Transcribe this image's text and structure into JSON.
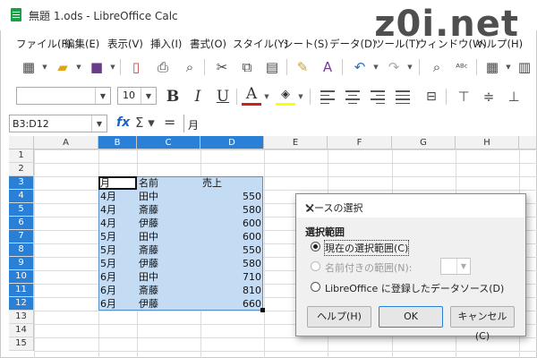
{
  "window": {
    "title": "無題 1.ods - LibreOffice Calc",
    "watermark": "z0i.net"
  },
  "menu": [
    "ファイル(F)",
    "編集(E)",
    "表示(V)",
    "挿入(I)",
    "書式(O)",
    "スタイル(Y)",
    "シート(S)",
    "データ(D)",
    "ツール(T)",
    "ウィンドウ(W)",
    "ヘルプ(H)"
  ],
  "toolbar": {
    "font_name": "",
    "font_size": "10"
  },
  "formula_bar": {
    "name_box": "B3:D12",
    "content": "月"
  },
  "columns": [
    "A",
    "B",
    "C",
    "D",
    "E",
    "F",
    "G",
    "H"
  ],
  "rows": [
    "1",
    "2",
    "3",
    "4",
    "5",
    "6",
    "7",
    "8",
    "9",
    "10",
    "11",
    "12",
    "13",
    "14",
    "15"
  ],
  "table": {
    "headers": [
      "月",
      "名前",
      "売上"
    ],
    "rows": [
      [
        "4月",
        "田中",
        "550"
      ],
      [
        "4月",
        "斎藤",
        "580"
      ],
      [
        "4月",
        "伊藤",
        "600"
      ],
      [
        "5月",
        "田中",
        "600"
      ],
      [
        "5月",
        "斎藤",
        "550"
      ],
      [
        "5月",
        "伊藤",
        "580"
      ],
      [
        "6月",
        "田中",
        "710"
      ],
      [
        "6月",
        "斎藤",
        "810"
      ],
      [
        "6月",
        "伊藤",
        "660"
      ]
    ]
  },
  "dialog": {
    "title": "ソースの選択",
    "group_label": "選択範囲",
    "option_current": "現在の選択範囲(C)",
    "option_named": "名前付きの範囲(N):",
    "option_registered": "LibreOffice に登録したデータソース(D)",
    "help_button": "ヘルプ(H)",
    "ok_button": "OK",
    "cancel_button": "キャンセル(C)"
  },
  "colors": {
    "selection_header": "#2a7fd6",
    "selection_fill": "#c3dcf4",
    "app_icon": "#19a244"
  }
}
